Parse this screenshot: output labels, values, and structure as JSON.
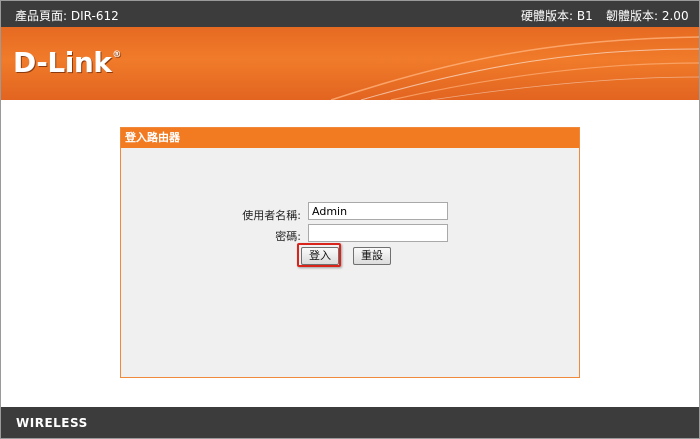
{
  "top_bar": {
    "product_page": "產品頁面: DIR-612",
    "hardware_version": "硬體版本: B1",
    "firmware_version": "韌體版本: 2.00"
  },
  "brand": {
    "logo_text": "D-Link",
    "registered_mark": "®",
    "footer_text": "WIRELESS"
  },
  "login": {
    "header": "登入路由器",
    "username_label": "使用者名稱:",
    "username_value": "Admin",
    "password_label": "密碼:",
    "password_value": "",
    "login_button": "登入",
    "reset_button": "重設"
  },
  "colors": {
    "accent_orange": "#f27b22",
    "top_bar_bg": "#3c3c3c",
    "highlight_red": "#d9241b"
  }
}
